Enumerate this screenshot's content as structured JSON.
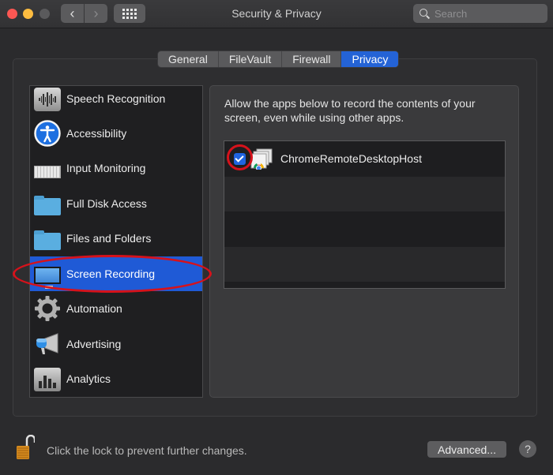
{
  "window": {
    "title": "Security & Privacy",
    "search_placeholder": "Search",
    "back_label": "‹",
    "forward_label": "›"
  },
  "tabs": [
    {
      "label": "General",
      "active": false
    },
    {
      "label": "FileVault",
      "active": false
    },
    {
      "label": "Firewall",
      "active": false
    },
    {
      "label": "Privacy",
      "active": true
    }
  ],
  "sidebar": {
    "items": [
      {
        "label": "Speech Recognition",
        "icon": "speech-recognition-icon"
      },
      {
        "label": "Accessibility",
        "icon": "accessibility-icon"
      },
      {
        "label": "Input Monitoring",
        "icon": "keyboard-icon"
      },
      {
        "label": "Full Disk Access",
        "icon": "folder-icon"
      },
      {
        "label": "Files and Folders",
        "icon": "folder-icon"
      },
      {
        "label": "Screen Recording",
        "icon": "monitor-icon",
        "selected": true
      },
      {
        "label": "Automation",
        "icon": "gear-icon"
      },
      {
        "label": "Advertising",
        "icon": "megaphone-icon"
      },
      {
        "label": "Analytics",
        "icon": "analytics-icon"
      }
    ]
  },
  "main": {
    "description": "Allow the apps below to record the contents of your screen, even while using other apps.",
    "apps": [
      {
        "name": "ChromeRemoteDesktopHost",
        "checked": true,
        "icon": "chrome-remote-desktop-icon"
      }
    ]
  },
  "footer": {
    "lock_text": "Click the lock to prevent further changes.",
    "advanced_label": "Advanced...",
    "help_label": "?"
  },
  "colors": {
    "accent": "#1f5ad6",
    "annotation": "#d6121b"
  }
}
